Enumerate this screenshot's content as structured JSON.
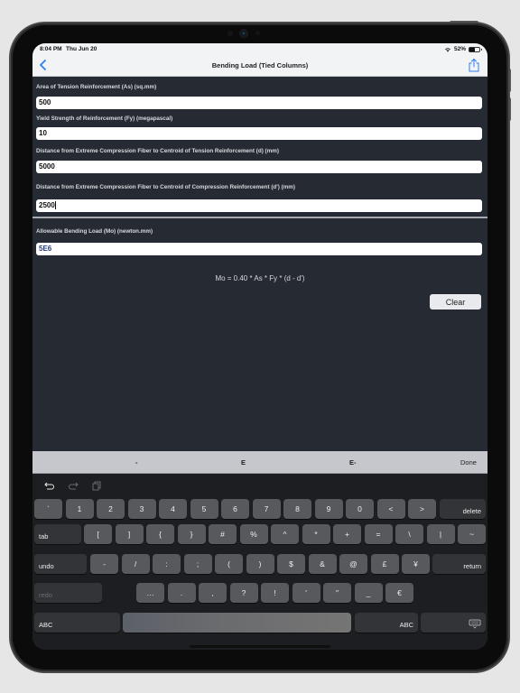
{
  "status_bar": {
    "time": "8:04 PM",
    "date": "Thu Jun 20",
    "battery_text": "52%",
    "battery_level": 0.52,
    "wifi_icon": "wifi-icon"
  },
  "nav": {
    "title": "Bending Load (Tied Columns)",
    "back_icon": "chevron-left-icon",
    "share_icon": "share-icon",
    "accent_color": "#2f7cf6"
  },
  "form": {
    "fields": [
      {
        "label": "Area of Tension Reinforcement (As) (sq.mm)",
        "value": "500"
      },
      {
        "label": "Yield Strength of Reinforcement (Fy) (megapascal)",
        "value": "10"
      },
      {
        "label": "Distance from Extreme Compression Fiber to Centroid of Tension Reinforcement (d) (mm)",
        "value": "5000"
      },
      {
        "label": "Distance from Extreme Compression Fiber to Centroid of Compression Reinforcement (d') (mm)",
        "value": "2500"
      }
    ],
    "result": {
      "label": "Allowable Bending Load (Mo) (newton.mm)",
      "value": "5E6"
    },
    "formula": "Mo = 0.40 * As * Fy * (d - d')",
    "clear_label": "Clear"
  },
  "accessory_bar": {
    "keys": [
      "-",
      "E",
      "E-"
    ],
    "done_label": "Done"
  },
  "keyboard": {
    "shortcuts": [
      "undo-icon",
      "redo-icon",
      "paste-icon"
    ],
    "row1": [
      "`",
      "1",
      "2",
      "3",
      "4",
      "5",
      "6",
      "7",
      "8",
      "9",
      "0",
      "<",
      ">"
    ],
    "delete_label": "delete",
    "tab_label": "tab",
    "row2": [
      "[",
      "]",
      "{",
      "}",
      "#",
      "%",
      "^",
      "*",
      "+",
      "=",
      "\\",
      "|",
      "~"
    ],
    "undo_label": "undo",
    "row3": [
      "-",
      "/",
      ":",
      ";",
      "(",
      ")",
      "$",
      "&",
      "@",
      "£",
      "¥"
    ],
    "return_label": "return",
    "redo_label": "redo",
    "row4": [
      "…",
      ".",
      ",",
      "?",
      "!",
      "′",
      "″",
      "_",
      "€"
    ],
    "abc_left_label": "ABC",
    "abc_right_label": "ABC",
    "dismiss_icon": "keyboard-dismiss-icon"
  }
}
